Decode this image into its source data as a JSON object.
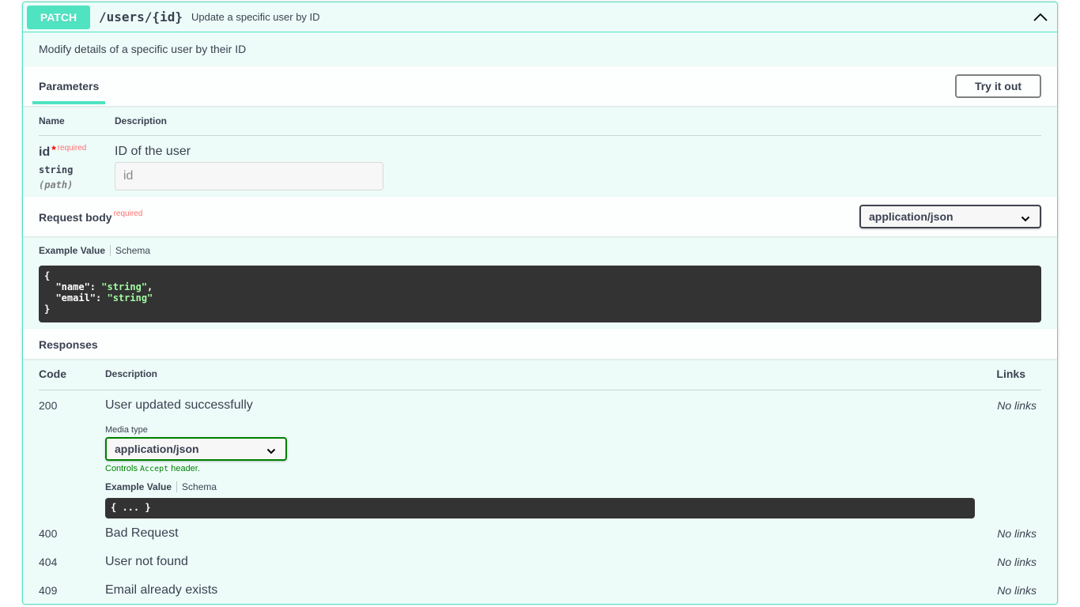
{
  "operation": {
    "method": "PATCH",
    "path": "/users/{id}",
    "summary": "Update a specific user by ID",
    "description": "Modify details of a specific user by their ID",
    "collapse_icon": "chevron-up-icon"
  },
  "parameters": {
    "title": "Parameters",
    "try_it_out_label": "Try it out",
    "columns": {
      "name": "Name",
      "description": "Description"
    },
    "items": [
      {
        "name": "id",
        "required_mark": "*",
        "required_label": "required",
        "type": "string",
        "in": "(path)",
        "description": "ID of the user",
        "placeholder": "id",
        "value": ""
      }
    ]
  },
  "request_body": {
    "title": "Request body",
    "required_label": "required",
    "content_type": "application/json",
    "tabs": {
      "example": "Example Value",
      "schema": "Schema"
    },
    "example_lines": {
      "open": "{",
      "name_key": "  \"name\": ",
      "name_val": "\"string\"",
      "name_comma": ",",
      "email_key": "  \"email\": ",
      "email_val": "\"string\"",
      "close": "}"
    }
  },
  "responses": {
    "title": "Responses",
    "columns": {
      "code": "Code",
      "description": "Description",
      "links": "Links"
    },
    "media_type_label": "Media type",
    "media_type": "application/json",
    "controls_prefix": "Controls ",
    "controls_code": "Accept",
    "controls_suffix": " header.",
    "tabs": {
      "example": "Example Value",
      "schema": "Schema"
    },
    "example_collapsed": "{ ... }",
    "items": [
      {
        "code": "200",
        "description": "User updated successfully",
        "links": "No links"
      },
      {
        "code": "400",
        "description": "Bad Request",
        "links": "No links"
      },
      {
        "code": "404",
        "description": "User not found",
        "links": "No links"
      },
      {
        "code": "409",
        "description": "Email already exists",
        "links": "No links"
      }
    ]
  },
  "colors": {
    "patch": "#50e3c2",
    "required": "#ff6f6f",
    "code_bg": "#333333",
    "string_value": "#a2fca2",
    "media_border": "#008000"
  }
}
